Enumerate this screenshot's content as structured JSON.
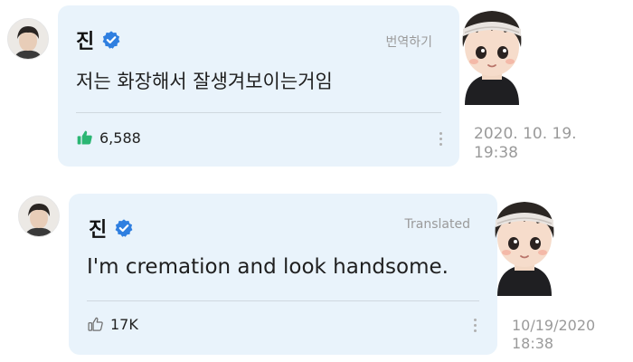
{
  "posts": [
    {
      "author": "진",
      "translate_label": "번역하기",
      "text": "저는 화장해서 잘생겨보이는거임",
      "likes": "6,588",
      "liked": true,
      "date": "2020. 10. 19.",
      "time": "19:38"
    },
    {
      "author": "진",
      "translate_label": "Translated",
      "text": "I'm cremation and look handsome.",
      "likes": "17K",
      "liked": false,
      "date": "10/19/2020",
      "time": "18:38"
    }
  ],
  "colors": {
    "bubble": "#e9f3fb",
    "verified": "#2f7fe0",
    "like_active": "#2bb673",
    "muted": "#9a9a9a"
  },
  "icons": {
    "verified": "verified-badge-icon",
    "like_filled": "thumbs-up-filled-icon",
    "like_outline": "thumbs-up-outline-icon",
    "more": "more-vertical-icon"
  }
}
